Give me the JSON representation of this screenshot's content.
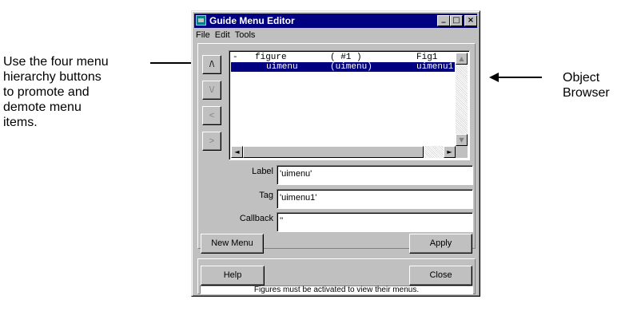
{
  "annotations": {
    "left_lines": [
      "Use the four menu",
      "hierarchy buttons",
      "to promote and",
      "demote menu",
      "items."
    ],
    "right_lines": [
      "Object",
      "Browser"
    ]
  },
  "window": {
    "title": "Guide Menu Editor",
    "controls": {
      "minimize": "_",
      "maximize": "□",
      "close": "×"
    }
  },
  "menubar": [
    "File",
    "Edit",
    "Tools"
  ],
  "hierarchy_buttons": {
    "promote": "/\\",
    "demote": "\\/",
    "left": "<",
    "right": ">"
  },
  "browser": {
    "rows": [
      {
        "toggle": "-",
        "name": "figure",
        "handle": "( #1 )",
        "tag": "Fig1",
        "selected": false
      },
      {
        "toggle": "",
        "name": "uimenu",
        "handle": "(uimenu)",
        "tag": "uimenu1",
        "selected": true
      }
    ]
  },
  "fields": {
    "label": {
      "caption": "Label",
      "value": "'uimenu'"
    },
    "tag": {
      "caption": "Tag",
      "value": "'uimenu1'"
    },
    "callback": {
      "caption": "Callback",
      "value": "''"
    }
  },
  "buttons": {
    "new_menu": "New Menu",
    "apply": "Apply",
    "help": "Help",
    "close": "Close"
  },
  "status_text": "Figures must be activated to view their menus.",
  "colors": {
    "title_bar": "#000080",
    "selection": "#000080",
    "face": "#c0c0c0"
  }
}
